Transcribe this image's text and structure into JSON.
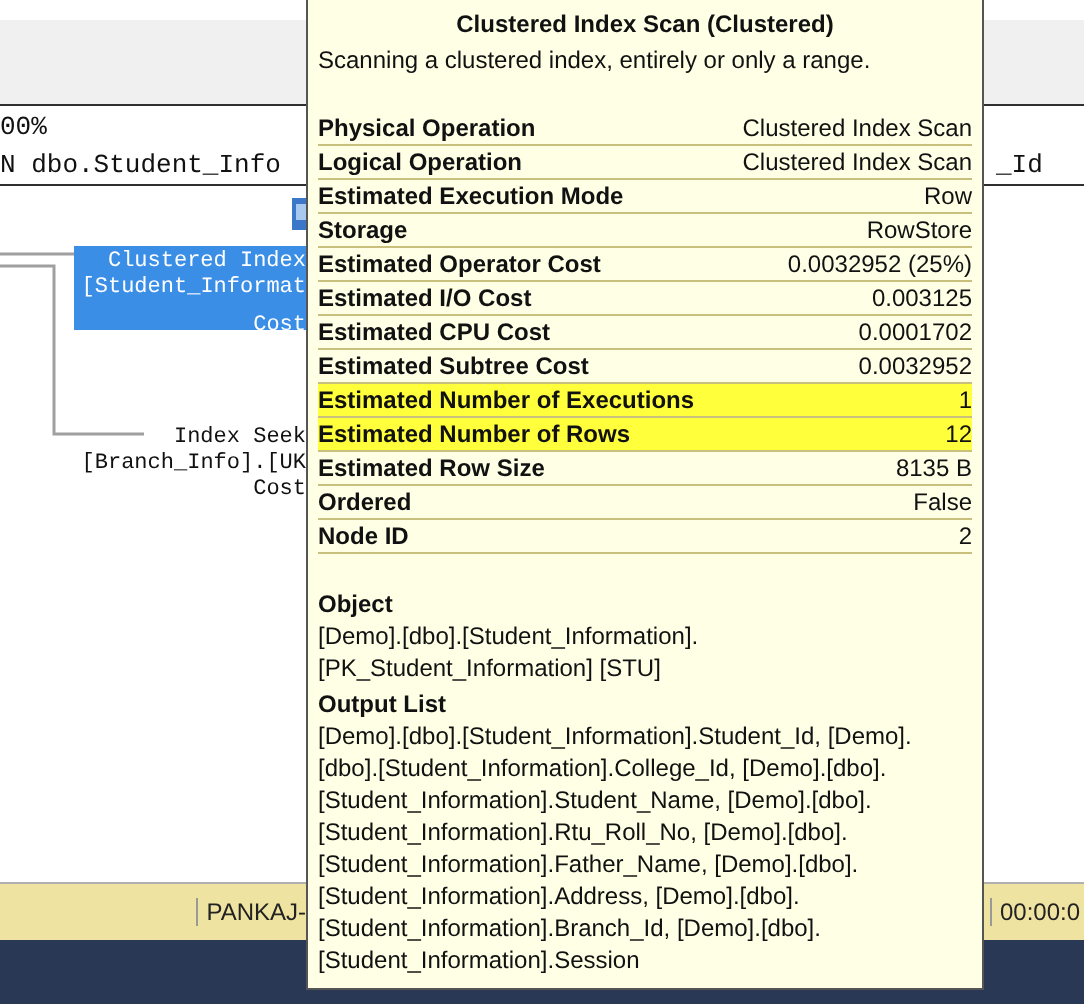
{
  "query_pane": {
    "zoom": "00%",
    "query_left": "N dbo.Student_Info",
    "query_right": "_Id"
  },
  "plan": {
    "selected_node": {
      "lines": [
        "Clustered Index",
        "[Student_Informat",
        "Cost"
      ],
      "selected": true
    },
    "other_node": {
      "lines": [
        "Index Seek",
        "[Branch_Info].[UK",
        "Cost"
      ],
      "selected": false
    }
  },
  "tooltip": {
    "title": "Clustered Index Scan (Clustered)",
    "description": "Scanning a clustered index, entirely or only a range.",
    "properties": [
      {
        "label": "Physical Operation",
        "value": "Clustered Index Scan",
        "highlighted": false
      },
      {
        "label": "Logical Operation",
        "value": "Clustered Index Scan",
        "highlighted": false
      },
      {
        "label": "Estimated Execution Mode",
        "value": "Row",
        "highlighted": false
      },
      {
        "label": "Storage",
        "value": "RowStore",
        "highlighted": false
      },
      {
        "label": "Estimated Operator Cost",
        "value": "0.0032952 (25%)",
        "highlighted": false
      },
      {
        "label": "Estimated I/O Cost",
        "value": "0.003125",
        "highlighted": false
      },
      {
        "label": "Estimated CPU Cost",
        "value": "0.0001702",
        "highlighted": false
      },
      {
        "label": "Estimated Subtree Cost",
        "value": "0.0032952",
        "highlighted": false
      },
      {
        "label": "Estimated Number of Executions",
        "value": "1",
        "highlighted": true
      },
      {
        "label": "Estimated Number of Rows",
        "value": "12",
        "highlighted": true
      },
      {
        "label": "Estimated Row Size",
        "value": "8135 B",
        "highlighted": false
      },
      {
        "label": "Ordered",
        "value": "False",
        "highlighted": false
      },
      {
        "label": "Node ID",
        "value": "2",
        "highlighted": false
      }
    ],
    "sections": [
      {
        "heading": "Object",
        "lines": [
          "[Demo].[dbo].[Student_Information].",
          "[PK_Student_Information] [STU]"
        ]
      },
      {
        "heading": "Output List",
        "lines": [
          "[Demo].[dbo].[Student_Information].Student_Id, [Demo].",
          "[dbo].[Student_Information].College_Id, [Demo].[dbo].",
          "[Student_Information].Student_Name, [Demo].[dbo].",
          "[Student_Information].Rtu_Roll_No, [Demo].[dbo].",
          "[Student_Information].Father_Name, [Demo].[dbo].",
          "[Student_Information].Address, [Demo].[dbo].",
          "[Student_Information].Branch_Id, [Demo].[dbo].",
          "[Student_Information].Session"
        ]
      }
    ]
  },
  "status_bar": {
    "server": "PANKAJ-",
    "time": "00:00:0"
  }
}
